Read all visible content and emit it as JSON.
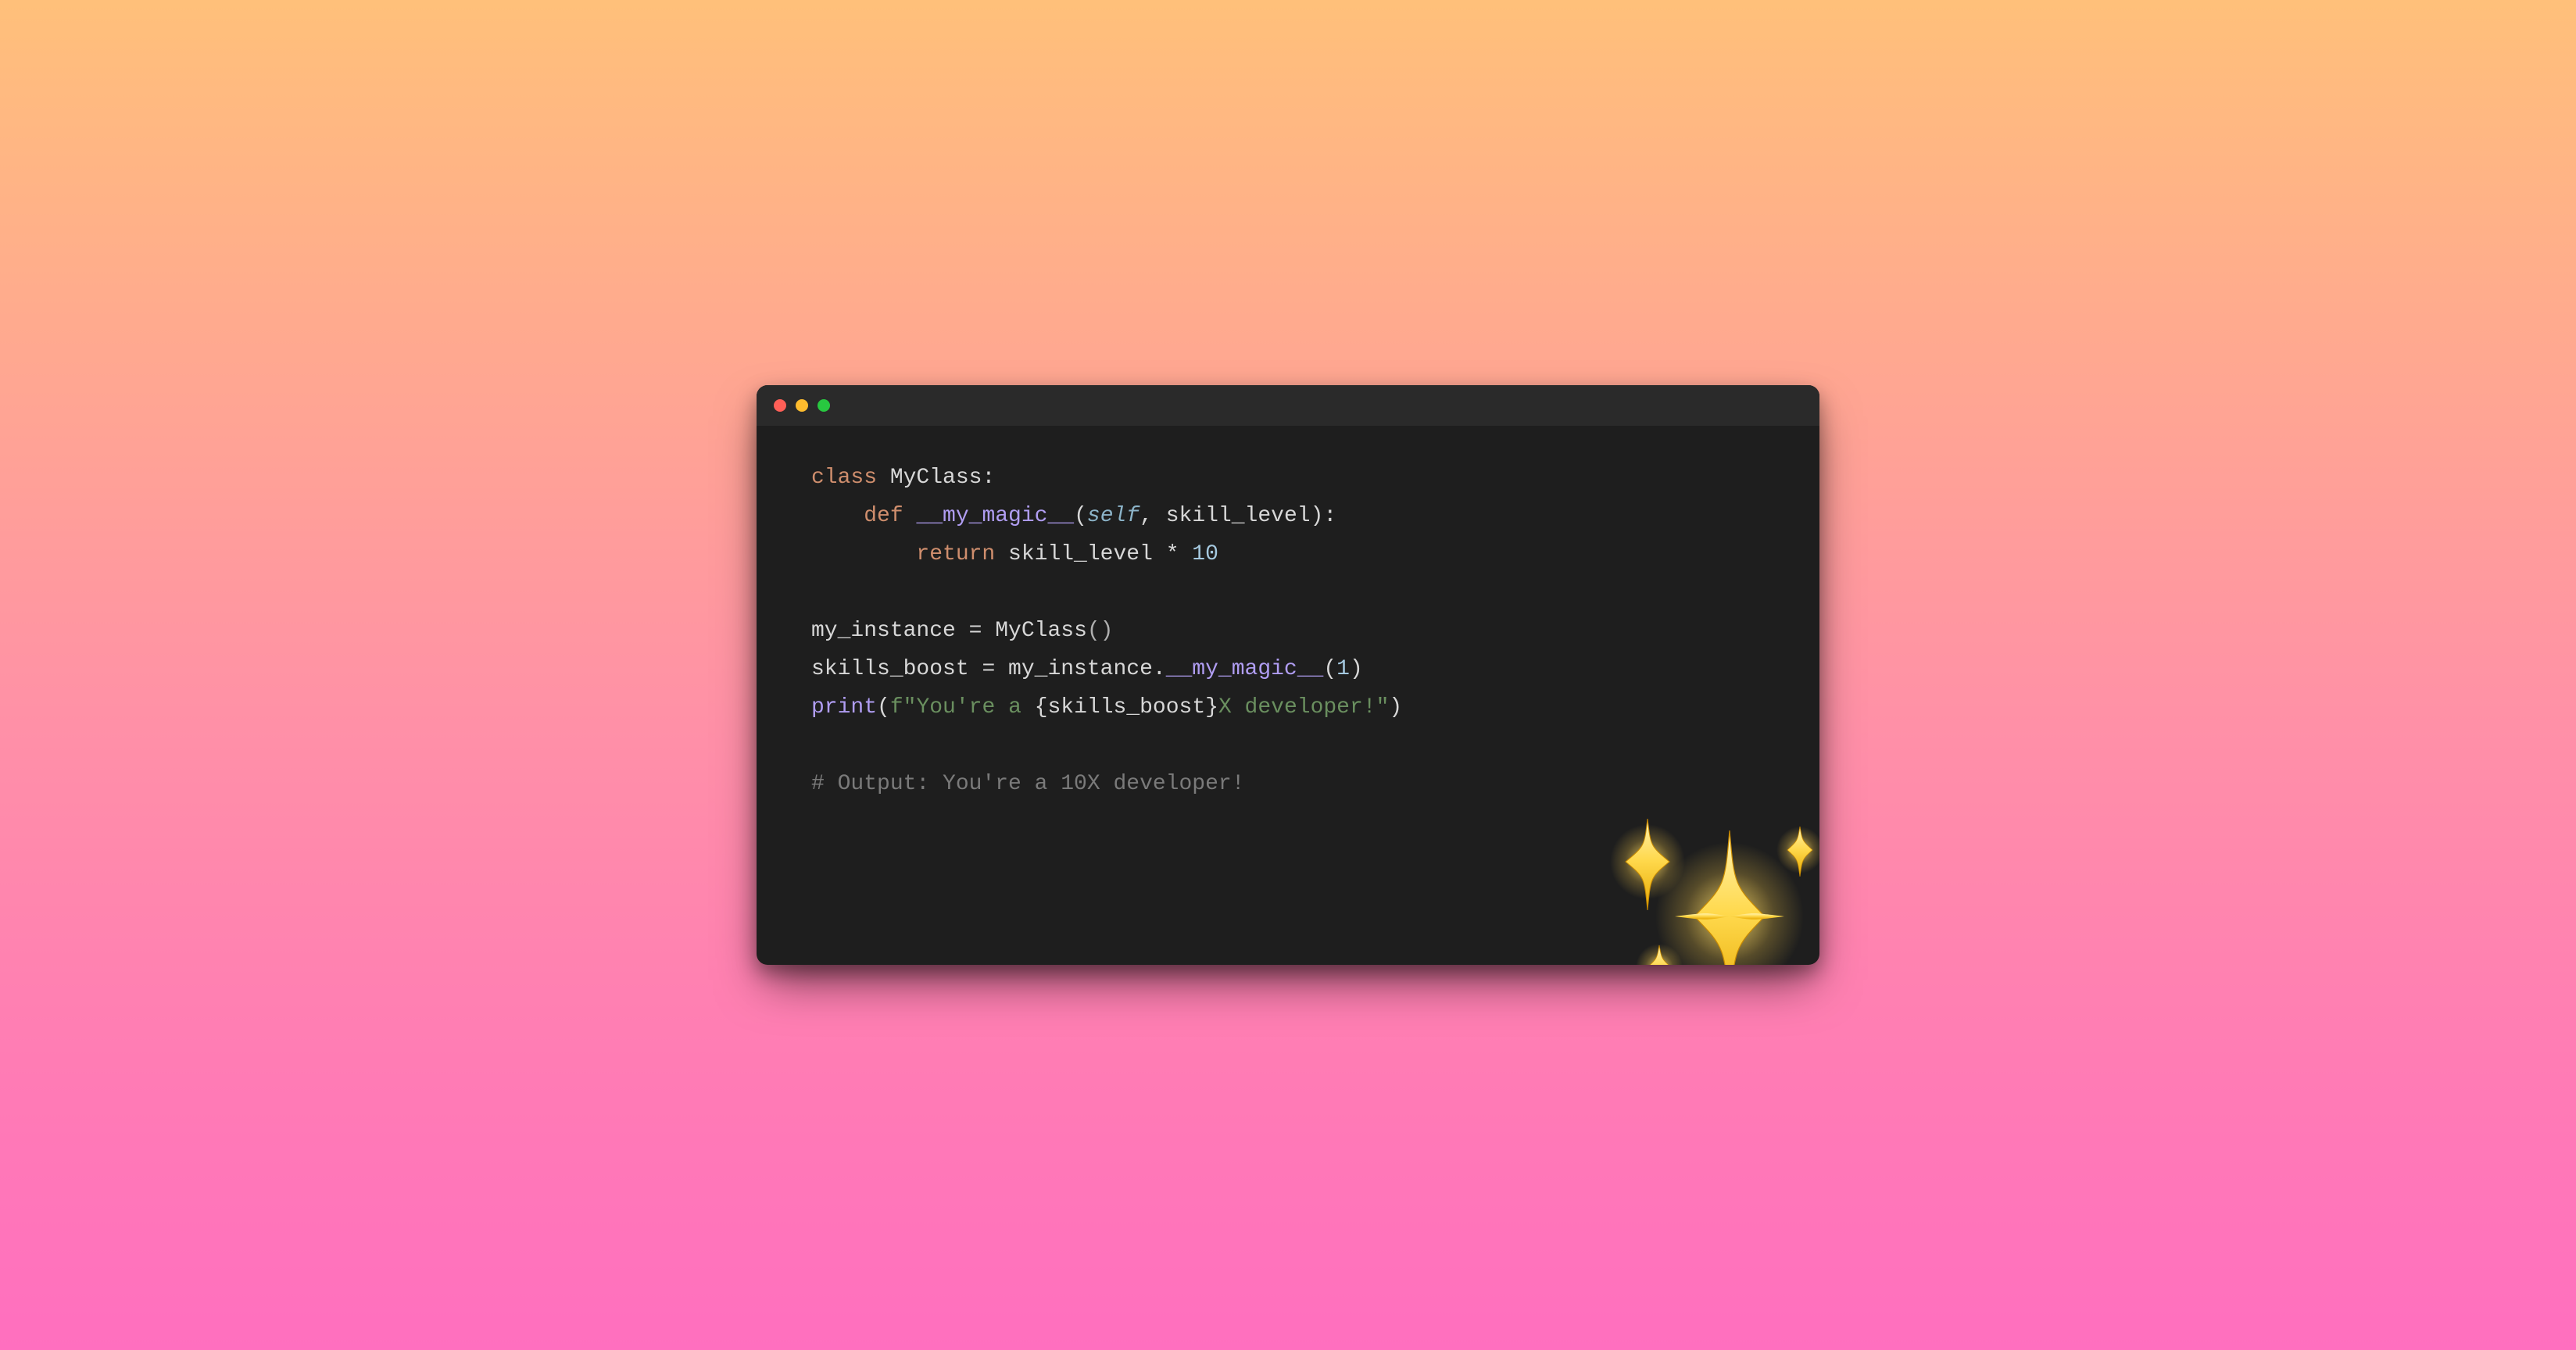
{
  "titlebar": {
    "close_color": "#ff5f57",
    "minimize_color": "#febc2e",
    "zoom_color": "#28c840"
  },
  "code": {
    "line1": {
      "kw_class": "class ",
      "classname": "MyClass",
      "colon": ":"
    },
    "line2": {
      "indent": "    ",
      "kw_def": "def ",
      "funcname": "__my_magic__",
      "lparen": "(",
      "self": "self",
      "comma": ", ",
      "param": "skill_level",
      "rparen_colon": "):"
    },
    "line3": {
      "indent": "        ",
      "kw_return": "return ",
      "ident": "skill_level ",
      "op": "* ",
      "number": "10"
    },
    "line4": {
      "blank": ""
    },
    "line5": {
      "ident": "my_instance ",
      "eq": "= ",
      "classname": "MyClass",
      "call": "()"
    },
    "line6": {
      "ident": "skills_boost ",
      "eq": "= ",
      "obj": "my_instance",
      "dot": ".",
      "method": "__my_magic__",
      "lparen": "(",
      "number": "1",
      "rparen": ")"
    },
    "line7": {
      "func": "print",
      "lparen": "(",
      "fprefix": "f",
      "str_open": "\"",
      "str_a": "You're a ",
      "interp_open": "{",
      "interp_ident": "skills_boost",
      "interp_close": "}",
      "str_b": "X developer!",
      "str_close": "\"",
      "rparen": ")"
    },
    "line8": {
      "blank": ""
    },
    "line9": {
      "comment": "# Output: You're a 10X developer!"
    }
  },
  "decoration": {
    "sparkles_name": "sparkles-icon"
  }
}
